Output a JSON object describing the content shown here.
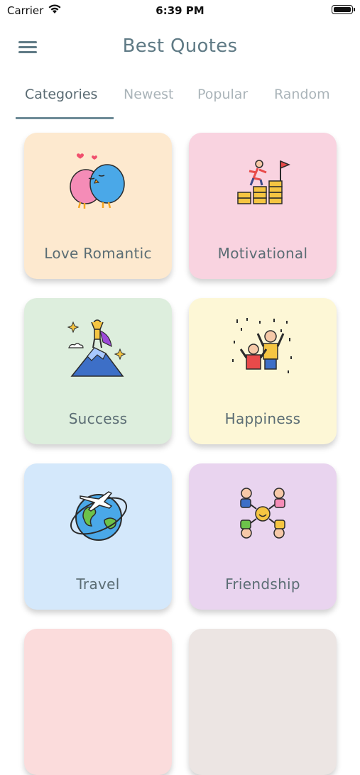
{
  "status_bar": {
    "carrier": "Carrier",
    "time": "6:39 PM"
  },
  "header": {
    "title": "Best Quotes",
    "menu_icon": "hamburger-menu-icon"
  },
  "tabs": [
    {
      "label": "Categories",
      "active": true
    },
    {
      "label": "Newest",
      "active": false
    },
    {
      "label": "Popular",
      "active": false
    },
    {
      "label": "Random",
      "active": false
    }
  ],
  "categories": [
    {
      "label": "Love Romantic",
      "color": "#fde9cf",
      "icon": "lovebirds-icon"
    },
    {
      "label": "Motivational",
      "color": "#f9d3e0",
      "icon": "climbing-coins-icon"
    },
    {
      "label": "Success",
      "color": "#ddeedd",
      "icon": "mountain-summit-icon"
    },
    {
      "label": "Happiness",
      "color": "#fdf7d6",
      "icon": "celebrating-people-icon"
    },
    {
      "label": "Travel",
      "color": "#d4e8fb",
      "icon": "globe-airplane-icon"
    },
    {
      "label": "Friendship",
      "color": "#e9d4ef",
      "icon": "friends-circle-icon"
    },
    {
      "label": "",
      "color": "#fbdcdc",
      "icon": ""
    },
    {
      "label": "",
      "color": "#ece5e3",
      "icon": ""
    }
  ]
}
